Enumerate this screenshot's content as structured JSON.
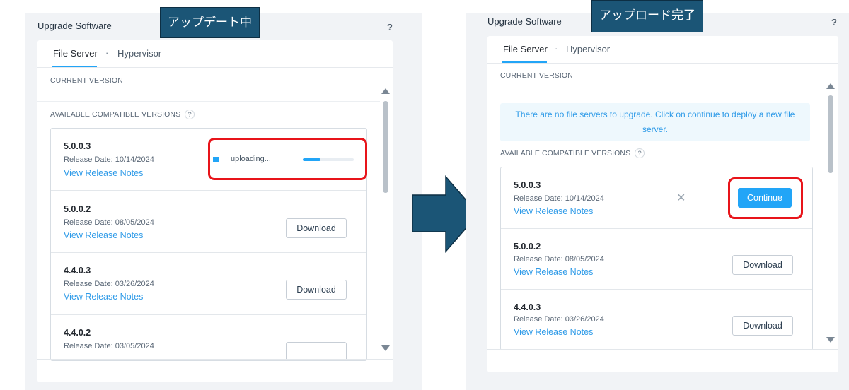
{
  "left": {
    "panel_title": "Upgrade Software",
    "help": "?",
    "callout": "アップデート中",
    "tabs": {
      "file_server": "File Server",
      "separator": "·",
      "hypervisor": "Hypervisor"
    },
    "current_version_label": "CURRENT VERSION",
    "available_label": "AVAILABLE COMPATIBLE VERSIONS",
    "available_help": "?",
    "progress": {
      "text": "uploading...",
      "fraction": 0.35
    },
    "versions": [
      {
        "version": "5.0.0.3",
        "release_date": "Release Date: 10/14/2024",
        "notes": "View Release Notes"
      },
      {
        "version": "5.0.0.2",
        "release_date": "Release Date: 08/05/2024",
        "notes": "View Release Notes",
        "button": "Download"
      },
      {
        "version": "4.4.0.3",
        "release_date": "Release Date: 03/26/2024",
        "notes": "View Release Notes",
        "button": "Download"
      },
      {
        "version": "4.4.0.2",
        "release_date": "Release Date: 03/05/2024"
      }
    ]
  },
  "right": {
    "panel_title": "Upgrade Software",
    "help": "?",
    "callout": "アップロード完了",
    "tabs": {
      "file_server": "File Server",
      "separator": "·",
      "hypervisor": "Hypervisor"
    },
    "current_version_label": "CURRENT VERSION",
    "info_message": "There are no file servers to upgrade. Click on continue to deploy a new file server.",
    "available_label": "AVAILABLE COMPATIBLE VERSIONS",
    "available_help": "?",
    "continue_button": "Continue",
    "versions": [
      {
        "version": "5.0.0.3",
        "release_date": "Release Date: 10/14/2024",
        "notes": "View Release Notes"
      },
      {
        "version": "5.0.0.2",
        "release_date": "Release Date: 08/05/2024",
        "notes": "View Release Notes",
        "button": "Download"
      },
      {
        "version": "4.4.0.3",
        "release_date": "Release Date: 03/26/2024",
        "notes": "View Release Notes",
        "button": "Download"
      }
    ]
  },
  "colors": {
    "accent": "#22a5f7",
    "callout": "#1b5576",
    "highlight": "#e8141a",
    "arrow": "#1b5576"
  }
}
